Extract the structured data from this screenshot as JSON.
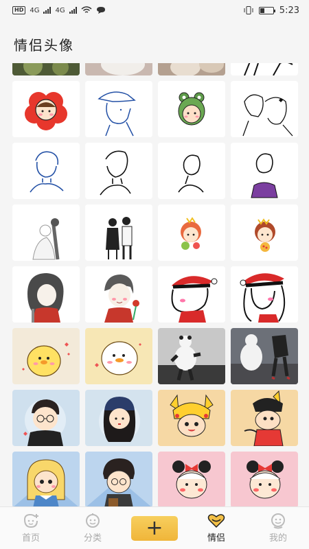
{
  "status_bar": {
    "hd": "HD",
    "net1": "4G",
    "net2": "4G",
    "time": "5:23"
  },
  "page_title": "情侣头像",
  "tabs": [
    {
      "label": "首页",
      "icon": "home-face-icon"
    },
    {
      "label": "分类",
      "icon": "category-face-icon"
    },
    {
      "label": "+",
      "icon": "plus-icon"
    },
    {
      "label": "情侣",
      "icon": "couple-heart-icon"
    },
    {
      "label": "我的",
      "icon": "profile-face-icon"
    }
  ],
  "colors": {
    "accent": "#f2bf46",
    "background": "#f5f5f5"
  }
}
